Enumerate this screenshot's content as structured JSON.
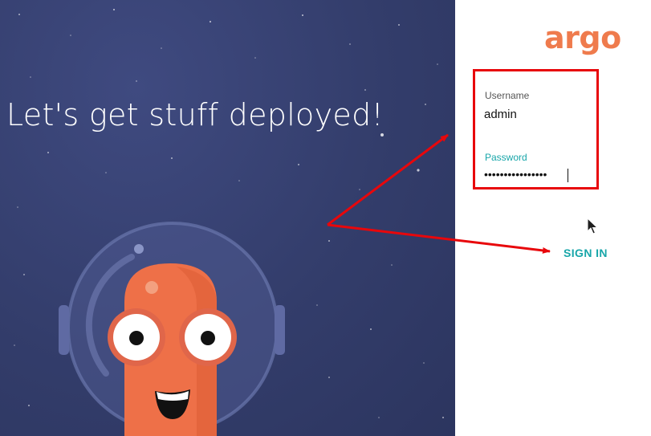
{
  "hero": {
    "tagline": "Let's get stuff deployed!",
    "background_color": "#333d6b",
    "text_color": "#ffffff",
    "mascot_icon": "argo-octopus-astronaut-icon"
  },
  "brand": {
    "logo_text": "argo",
    "logo_color": "#ef7b4d"
  },
  "login": {
    "username_label": "Username",
    "username_value": "admin",
    "password_label": "Password",
    "password_value": "••••••••••••••••",
    "label_color": "#555555",
    "focused_label_color": "#18a6a9",
    "sign_in_label": "SIGN IN",
    "sign_in_color": "#18a6a9"
  },
  "annotations": {
    "highlight_box_color": "#e8070b",
    "arrow_color": "#e8070b",
    "cursor_icon": "mouse-pointer-icon"
  }
}
